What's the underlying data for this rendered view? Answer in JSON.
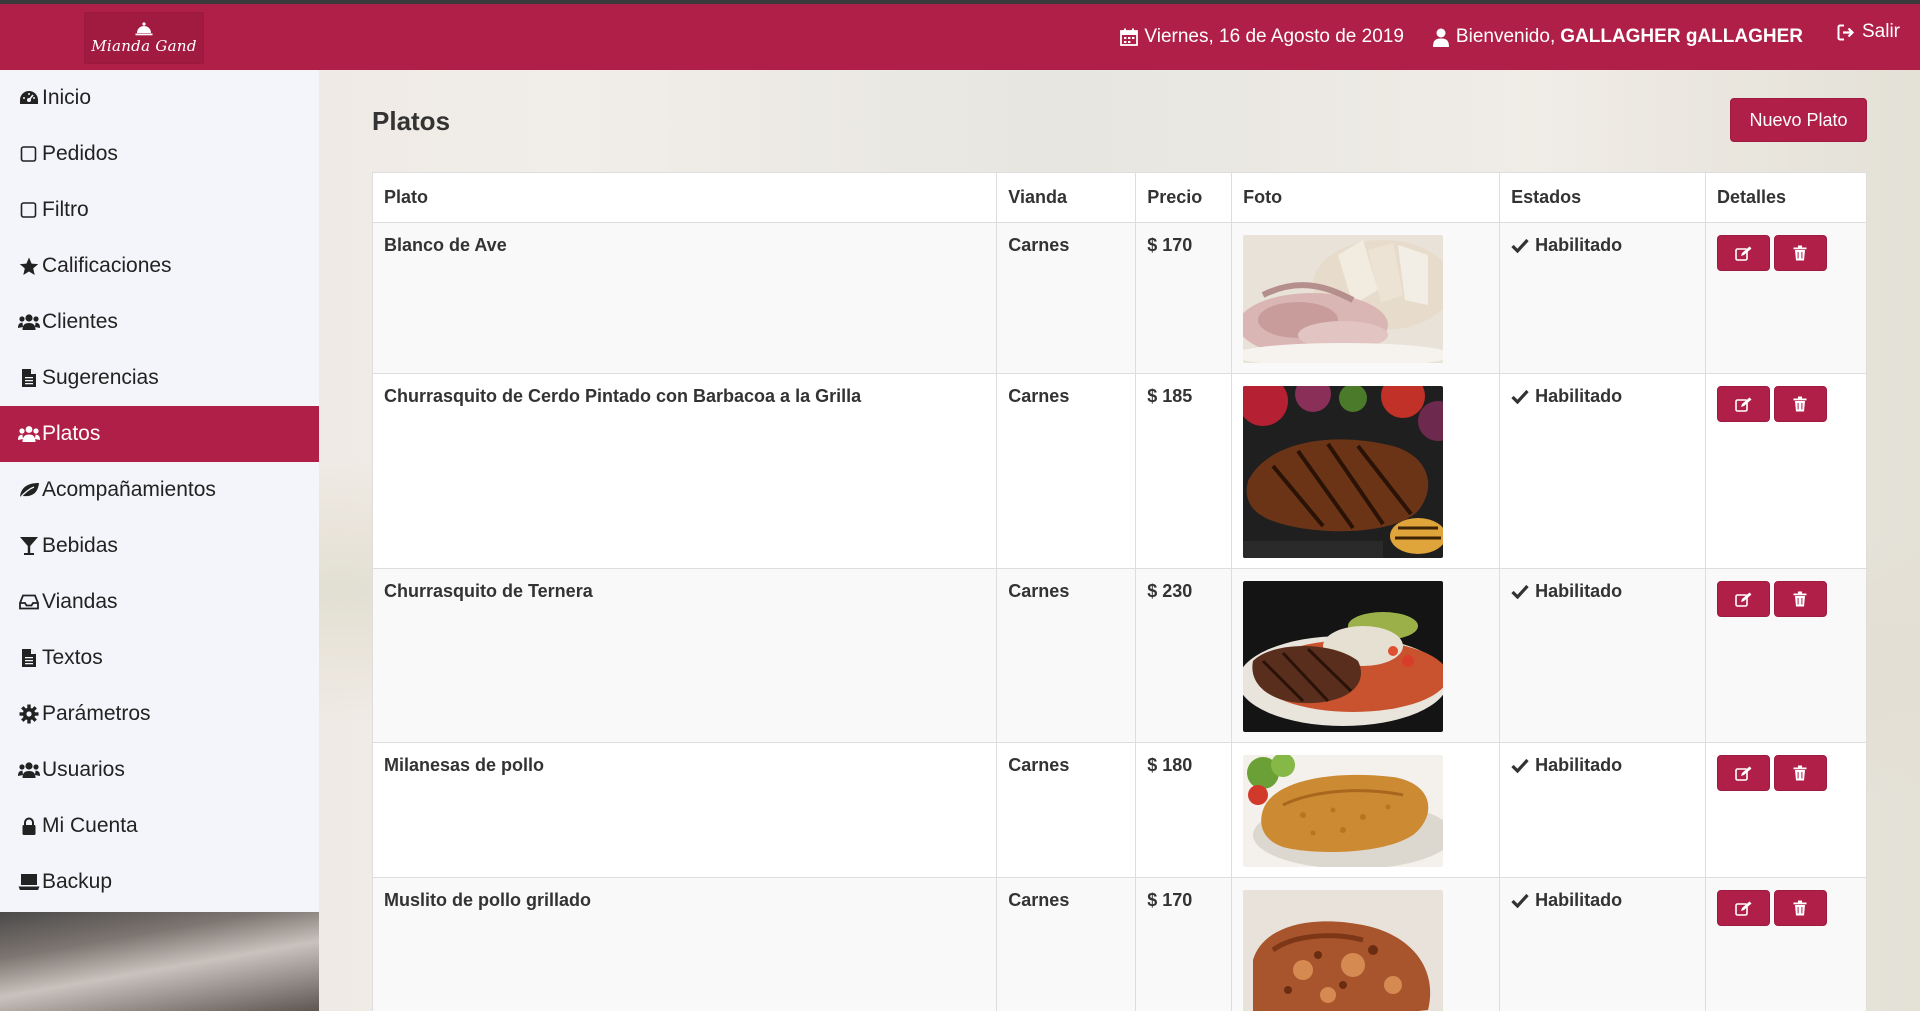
{
  "header": {
    "logo_text": "Mianda Gand",
    "date": "Viernes, 16 de Agosto de 2019",
    "welcome_prefix": "Bienvenido,",
    "user_name": "GALLAGHER gALLAGHER",
    "logout": "Salir",
    "brand_color": "#b01f48"
  },
  "sidebar": {
    "items": [
      {
        "label": "Inicio",
        "icon": "dashboard-icon"
      },
      {
        "label": "Pedidos",
        "icon": "checkbox-outline-icon"
      },
      {
        "label": "Filtro",
        "icon": "checkbox-outline-icon"
      },
      {
        "label": "Calificaciones",
        "icon": "star-icon"
      },
      {
        "label": "Clientes",
        "icon": "users-icon"
      },
      {
        "label": "Sugerencias",
        "icon": "document-icon"
      },
      {
        "label": "Platos",
        "icon": "paw-icon",
        "active": true
      },
      {
        "label": "Acompañamientos",
        "icon": "leaf-icon"
      },
      {
        "label": "Bebidas",
        "icon": "glass-icon"
      },
      {
        "label": "Viandas",
        "icon": "inbox-icon"
      },
      {
        "label": "Textos",
        "icon": "document-icon"
      },
      {
        "label": "Parámetros",
        "icon": "gear-icon"
      },
      {
        "label": "Usuarios",
        "icon": "users-icon"
      },
      {
        "label": "Mi Cuenta",
        "icon": "lock-icon"
      },
      {
        "label": "Backup",
        "icon": "laptop-icon"
      }
    ]
  },
  "main": {
    "title": "Platos",
    "new_button": "Nuevo Plato",
    "table": {
      "headers": [
        "Plato",
        "Vianda",
        "Precio",
        "Foto",
        "Estados",
        "Detalles"
      ],
      "rows": [
        {
          "plato": "Blanco de Ave",
          "vianda": "Carnes",
          "precio": "$ 170",
          "estado": "Habilitado",
          "photo": "chicken-breast"
        },
        {
          "plato": "Churrasquito de Cerdo Pintado con Barbacoa a la Grilla",
          "vianda": "Carnes",
          "precio": "$ 185",
          "estado": "Habilitado",
          "photo": "grilled-pork"
        },
        {
          "plato": "Churrasquito de Ternera",
          "vianda": "Carnes",
          "precio": "$ 230",
          "estado": "Habilitado",
          "photo": "veal-steak"
        },
        {
          "plato": "Milanesas de pollo",
          "vianda": "Carnes",
          "precio": "$ 180",
          "estado": "Habilitado",
          "photo": "chicken-milanesa"
        },
        {
          "plato": "Muslito de pollo grillado",
          "vianda": "Carnes",
          "precio": "$ 170",
          "estado": "Habilitado",
          "photo": "grilled-chicken-thigh"
        }
      ]
    }
  }
}
